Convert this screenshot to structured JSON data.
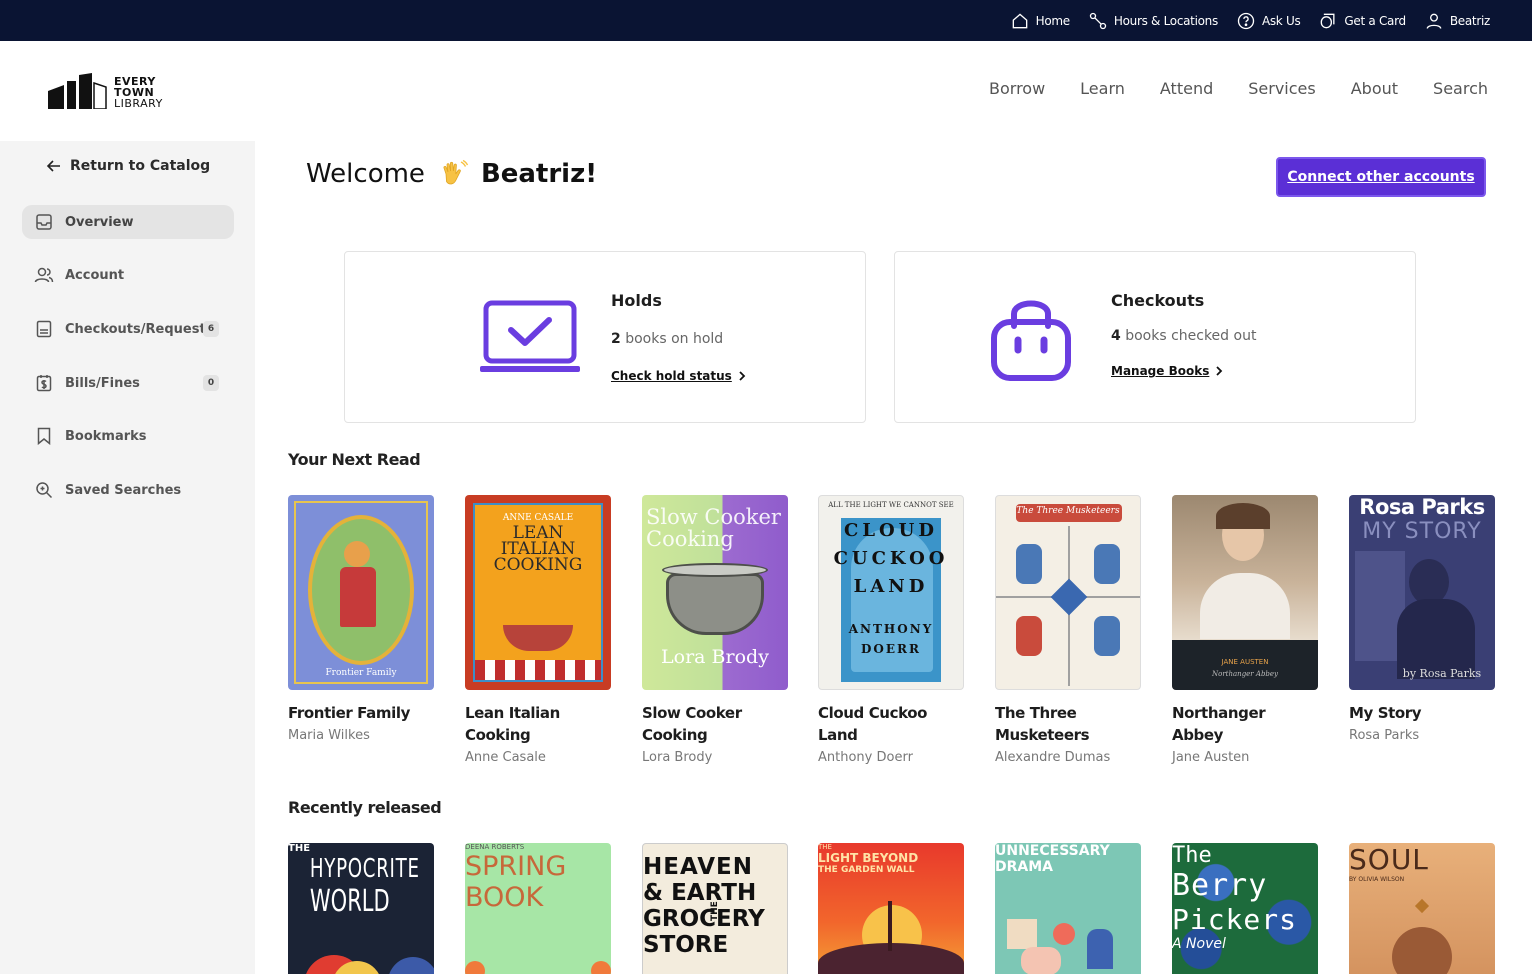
{
  "utility_nav": {
    "home": "Home",
    "hours": "Hours & Locations",
    "ask": "Ask Us",
    "card": "Get a Card",
    "user": "Beatriz"
  },
  "logo": {
    "line1": "EVERY",
    "line2": "TOWN",
    "line3": "LIBRARY"
  },
  "main_nav": [
    "Borrow",
    "Learn",
    "Attend",
    "Services",
    "About",
    "Search"
  ],
  "sidebar": {
    "return_label": "Return to Catalog",
    "items": [
      {
        "label": "Overview",
        "icon": "inbox-icon"
      },
      {
        "label": "Account",
        "icon": "users-icon"
      },
      {
        "label": "Checkouts/Requests",
        "icon": "list-icon",
        "badge": "6"
      },
      {
        "label": "Bills/Fines",
        "icon": "dollar-icon",
        "badge": "0"
      },
      {
        "label": "Bookmarks",
        "icon": "bookmark-icon"
      },
      {
        "label": "Saved Searches",
        "icon": "search-icon"
      }
    ]
  },
  "welcome": {
    "greeting": "Welcome",
    "name": "Beatriz!"
  },
  "connect_button": "Connect other accounts",
  "holds": {
    "title": "Holds",
    "count": "2",
    "desc": "books on hold",
    "link": "Check hold status"
  },
  "checkouts": {
    "title": "Checkouts",
    "count": "4",
    "desc": "books checked out",
    "link": "Manage Books"
  },
  "sections": {
    "next_read": "Your Next Read",
    "recent": "Recently released"
  },
  "next_read": [
    {
      "title": "Frontier Family",
      "author": "Maria Wilkes"
    },
    {
      "title": "Lean Italian Cooking",
      "author": "Anne  Casale"
    },
    {
      "title": "Slow Cooker Cooking",
      "author": "Lora Brody"
    },
    {
      "title": "Cloud Cuckoo Land",
      "author": "Anthony Doerr"
    },
    {
      "title": "The Three Musketeers",
      "author": "Alexandre Dumas"
    },
    {
      "title": "Northanger Abbey",
      "author": "Jane Austen"
    },
    {
      "title": "My Story",
      "author": "Rosa Parks"
    }
  ],
  "covers": {
    "frontier": "Frontier Family",
    "lean": [
      "ANNE CASALE",
      "LEAN",
      "ITALIAN",
      "COOKING"
    ],
    "slow": [
      "Slow Cooker",
      "Cooking",
      "Lora Brody"
    ],
    "cloud": [
      "ALL THE LIGHT WE CANNOT SEE",
      "CLOUD",
      "CUCKOO",
      "LAND",
      "ANTHONY",
      "DOERR"
    ],
    "musketeers": "The Three Musketeers",
    "northanger": [
      "JANE AUSTEN",
      "Northanger Abbey"
    ],
    "rosa": [
      "Rosa Parks",
      "MY STORY",
      "by Rosa Parks"
    ]
  },
  "recent_covers": [
    [
      "THE",
      "HYPOCRITE",
      "WORLD"
    ],
    [
      "DEENA ROBERTS",
      "SPRING",
      "BOOK"
    ],
    [
      "THE",
      "HEAVEN",
      "& EARTH",
      "GROCERY",
      "STORE"
    ],
    [
      "THE",
      "LIGHT BEYOND",
      "THE GARDEN WALL"
    ],
    [
      "UNNECESSARY",
      "DRAMA"
    ],
    [
      "The",
      "Berry",
      "Pickers",
      "A Novel"
    ],
    [
      "SOUL",
      "BY OLIVIA WILSON"
    ]
  ],
  "colors": {
    "accent": "#5b2fd6",
    "topbar": "#0a1433"
  }
}
